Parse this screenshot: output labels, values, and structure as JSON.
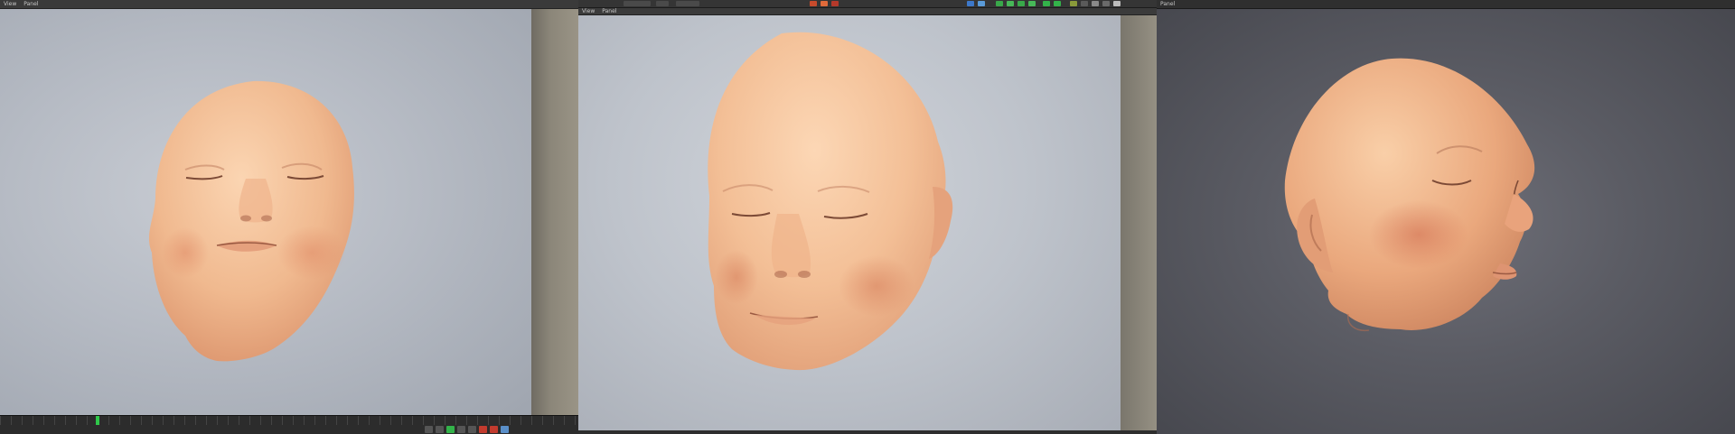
{
  "panels": [
    {
      "menu": [
        "View",
        "Panel"
      ]
    },
    {
      "menu": [
        "View",
        "Panel"
      ]
    },
    {
      "menu": [
        "Panel"
      ]
    }
  ],
  "colors": {
    "skin_light": "#f6c9a4",
    "skin_mid": "#e9ad85",
    "skin_shadow": "#c98461",
    "blush": "#d98a6f",
    "playhead": "#2fc84a"
  },
  "icons": {
    "timeline_transport": [
      "first-frame-icon",
      "prev-frame-icon",
      "play-icon",
      "next-frame-icon",
      "last-frame-icon",
      "record-icon"
    ]
  }
}
